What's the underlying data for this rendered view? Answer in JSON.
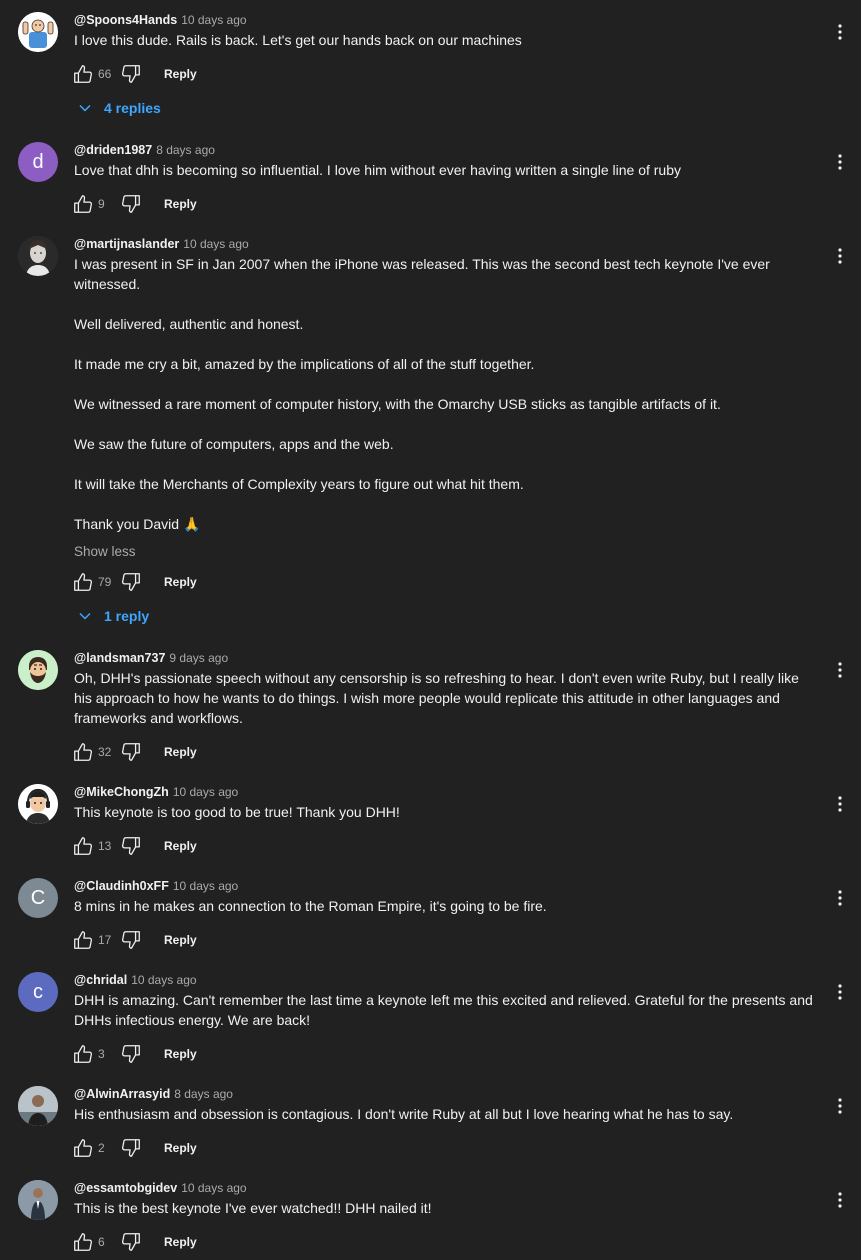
{
  "comments": [
    {
      "author": "@Spoons4Hands",
      "time": "10 days ago",
      "avatar_icon": "cartoon-avatar-icon",
      "avatar_color": "#ffffff",
      "paragraphs": [
        "I love this dude. Rails is back. Let's get our hands back on our machines"
      ],
      "likes": "66",
      "reply_label": "Reply",
      "replies_label": "4 replies"
    },
    {
      "author": "@driden1987",
      "time": "8 days ago",
      "avatar_letter": "d",
      "avatar_color": "#8c5ec4",
      "paragraphs": [
        "Love that dhh is becoming so influential. I love him without ever having written a single line of ruby"
      ],
      "likes": "9",
      "reply_label": "Reply"
    },
    {
      "author": "@martijnaslander",
      "time": "10 days ago",
      "avatar_icon": "profile-photo-icon",
      "paragraphs": [
        "I was present in SF in Jan 2007 when the iPhone was released. This was the second best tech keynote I've ever witnessed.",
        "Well delivered, authentic and honest.",
        "It made me cry a bit, amazed by the implications of all of the stuff together.",
        "We witnessed a rare moment of computer history, with the Omarchy USB sticks as tangible artifacts of it.",
        "We saw the future of computers, apps and the web.",
        "It will take the Merchants of Complexity years to figure out what hit them.",
        "Thank you David 🙏"
      ],
      "show_less": "Show less",
      "likes": "79",
      "reply_label": "Reply",
      "replies_label": "1 reply"
    },
    {
      "author": "@landsman737",
      "time": "9 days ago",
      "avatar_icon": "bearded-emoji-avatar-icon",
      "avatar_color": "#c9f0c9",
      "paragraphs": [
        "Oh, DHH's passionate speech without any censorship is so refreshing to hear. I don't even write Ruby, but I really like his approach to how he wants to do things. I wish more people would replicate this attitude in other languages and frameworks and workflows."
      ],
      "likes": "32",
      "reply_label": "Reply"
    },
    {
      "author": "@MikeChongZh",
      "time": "10 days ago",
      "avatar_icon": "headphones-avatar-icon",
      "avatar_color": "#ffffff",
      "paragraphs": [
        "This keynote is too good to be true! Thank you DHH!"
      ],
      "likes": "13",
      "reply_label": "Reply"
    },
    {
      "author": "@Claudinh0xFF",
      "time": "10 days ago",
      "avatar_letter": "C",
      "avatar_color": "#7d8a93",
      "paragraphs": [
        "8 mins in he makes an connection to the Roman Empire, it's going to be fire."
      ],
      "likes": "17",
      "reply_label": "Reply"
    },
    {
      "author": "@chridal",
      "time": "10 days ago",
      "avatar_letter": "c",
      "avatar_color": "#5c6bc0",
      "paragraphs": [
        "DHH is amazing. Can't remember the last time a keynote left me this excited and relieved. Grateful for the presents and DHHs infectious energy. We are back!"
      ],
      "likes": "3",
      "reply_label": "Reply"
    },
    {
      "author": "@AlwinArrasyid",
      "time": "8 days ago",
      "avatar_icon": "profile-photo-icon",
      "avatar_color": "#b9c3c9",
      "paragraphs": [
        "His enthusiasm and obsession is contagious. I don't write Ruby at all but I love hearing what he has to say."
      ],
      "likes": "2",
      "reply_label": "Reply"
    },
    {
      "author": "@essamtobgidev",
      "time": "10 days ago",
      "avatar_icon": "profile-photo-icon",
      "avatar_color": "#8b9aa6",
      "paragraphs": [
        "This is the best keynote I've ever watched!! DHH nailed it!"
      ],
      "likes": "6",
      "reply_label": "Reply"
    }
  ],
  "colors": {
    "background": "#212121",
    "text": "#f1f1f1",
    "secondary_text": "#aaaaaa",
    "link_blue": "#3ea6ff"
  }
}
